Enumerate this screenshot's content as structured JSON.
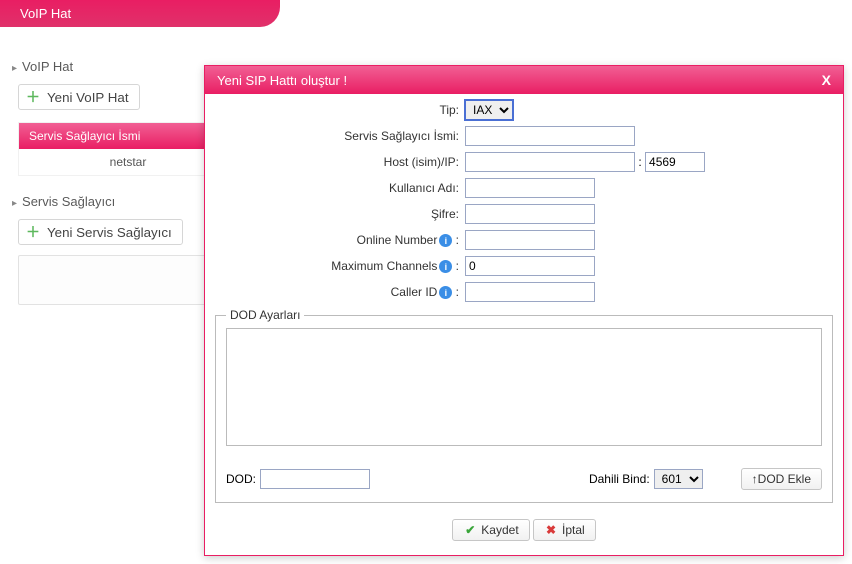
{
  "topTab": "VoIP Hat",
  "left": {
    "section1": {
      "title": "VoIP Hat",
      "addBtn": "Yeni VoIP Hat",
      "providerHead": "Servis Sağlayıcı İsmi",
      "providerRow": "netstar"
    },
    "section2": {
      "title": "Servis Sağlayıcı",
      "addBtn": "Yeni Servis Sağlayıcı"
    }
  },
  "dialog": {
    "title": "Yeni SIP Hattı oluştur !",
    "close": "X",
    "labels": {
      "tip": "Tip:",
      "provider": "Servis Sağlayıcı İsmi:",
      "host": "Host (isim)/IP:",
      "user": "Kullanıcı Adı:",
      "pass": "Şifre:",
      "online": "Online Number",
      "max": "Maximum Channels",
      "caller": "Caller ID",
      "port": "4569",
      "maxVal": "0"
    },
    "tipOptions": [
      "IAX"
    ],
    "dod": {
      "legend": "DOD Ayarları",
      "dodLabel": "DOD:",
      "bindLabel": "Dahili Bind:",
      "bindOptions": [
        "601"
      ],
      "addBtn": "↑DOD Ekle"
    },
    "buttons": {
      "save": "Kaydet",
      "cancel": "İptal"
    }
  }
}
